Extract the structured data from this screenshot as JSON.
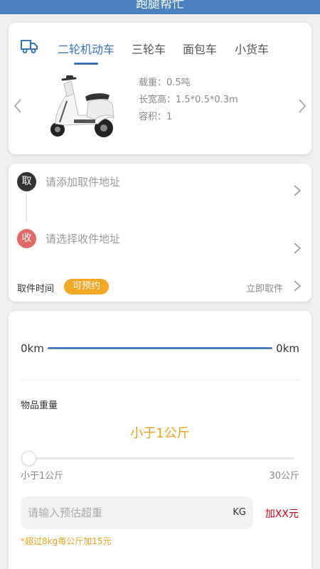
{
  "header": {
    "title": "跑腿帮忙"
  },
  "vehicle_tabs": [
    "二轮机动车",
    "三轮车",
    "面包车",
    "小货车"
  ],
  "vehicle_specs": {
    "load": "载重：0.5吨",
    "size": "长宽高：1.5*0.5*0.3m",
    "volume": "容积：1"
  },
  "address": {
    "pickup_badge": "取",
    "pickup_placeholder": "请添加取件地址",
    "receive_badge": "收",
    "receive_placeholder": "请选择收件地址",
    "time_label": "取件时间",
    "reserve_badge": "可预约",
    "pickup_now": "立即取件"
  },
  "distance": {
    "start": "0km",
    "end": "0km"
  },
  "weight": {
    "label": "物品重量",
    "value": "小于1公斤",
    "range_min": "小于1公斤",
    "range_max": "30公斤",
    "slider_fraction": 0,
    "input_placeholder": "请输入预估超重",
    "unit": "KG",
    "surcharge": "加XX元",
    "note": "*超过8kg每公斤加15元"
  },
  "colors": {
    "primary": "#3b73b9",
    "accent": "#f5a623",
    "danger": "#d0021b"
  }
}
